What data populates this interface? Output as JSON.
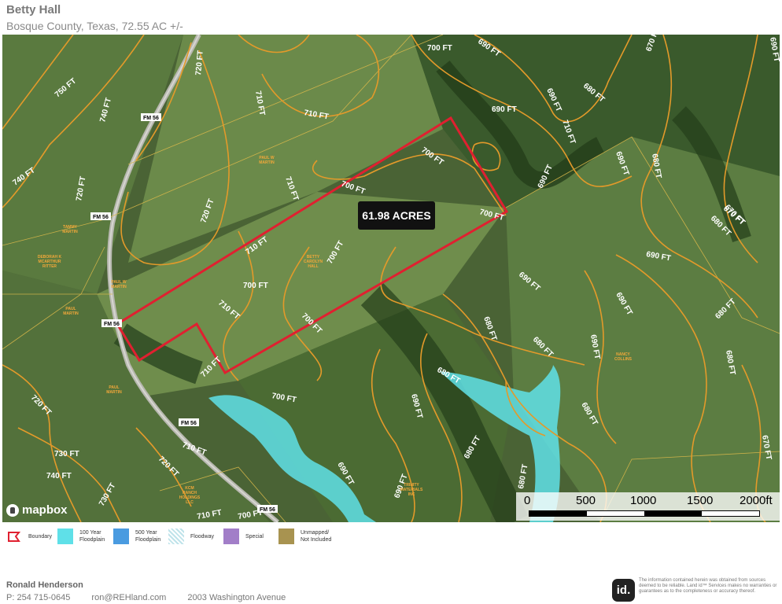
{
  "header": {
    "title": "Betty Hall",
    "subtitle": "Bosque County, Texas, 72.55 AC +/-"
  },
  "map": {
    "acreage_label": "61.98 ACRES",
    "contour_labels": [
      "700 FT",
      "690 FT",
      "690 FT",
      "670 FT",
      "700 FT",
      "690 FT",
      "680 FT",
      "690 FT",
      "680 FT",
      "690 FT",
      "680 FT",
      "670 FT",
      "750 FT",
      "740 FT",
      "720 FT",
      "740 FT",
      "710 FT",
      "710 FT",
      "720 FT",
      "710 FT",
      "700 FT",
      "710 FT",
      "700 FT",
      "720 FT",
      "710 FT",
      "700 FT",
      "700 FT",
      "700 FT",
      "690 FT",
      "690 FT",
      "680 FT",
      "680 FT",
      "690 FT",
      "680 FT",
      "680 FT",
      "690 FT",
      "680 FT",
      "680 FT",
      "720 FT",
      "720 FT",
      "730 FT",
      "740 FT",
      "730 FT",
      "710 FT",
      "710 FT",
      "700 FT",
      "700 FT",
      "690 FT",
      "690 FT",
      "690 FT",
      "680 FT",
      "680 FT",
      "670 FT",
      "710 FT",
      "670 FT",
      "710 FT",
      "690 FT"
    ],
    "road_labels": [
      "FM 56",
      "FM 56",
      "FM 56",
      "FM 56",
      "FM 56"
    ],
    "owner_labels": [
      "PAUL W\nMARTIN",
      "TAMMY\nMARTIN",
      "DEBORAH K\nMCARTHUR\nRITTER",
      "PAUL W\nMARTIN",
      "PAUL\nMARTIN",
      "BETTY\nCAROLYN\nHALL",
      "NANCY\nCOLLINS",
      "PAUL\nMARTIN",
      "TRINITY\nMATERIALS\nINC",
      "KCM\nRANCH\nHOLDINGS\nLLC"
    ],
    "mapbox_brand": "mapbox",
    "scale": {
      "labels": [
        "0",
        "500",
        "1000",
        "1500",
        "2000ft"
      ],
      "max": 2000
    }
  },
  "legend": [
    {
      "label": "Boundary",
      "icon": "boundary-outline-icon",
      "color": "#e02030"
    },
    {
      "label": "100 Year\nFloodplain",
      "color": "#5fe0e8"
    },
    {
      "label": "500 Year\nFloodplain",
      "color": "#4a9be0"
    },
    {
      "label": "Floodway",
      "color": "#bfe3ea"
    },
    {
      "label": "Special",
      "color": "#a27ec8"
    },
    {
      "label": "Unmapped/\nNot Included",
      "color": "#a89350"
    }
  ],
  "footer": {
    "agent_name": "Ronald Henderson",
    "phone": "P: 254 715-0645",
    "email": "ron@REHland.com",
    "address": "2003 Washington Avenue",
    "brand_mark": "id.",
    "disclaimer": "The information contained herein was obtained from sources deemed to be reliable. Land id™ Services makes no warranties or guarantees as to the completeness or accuracy thereof."
  },
  "colors": {
    "boundary": "#e02030",
    "contour": "#e39a2a",
    "floodplain": "#5fe0e8"
  }
}
